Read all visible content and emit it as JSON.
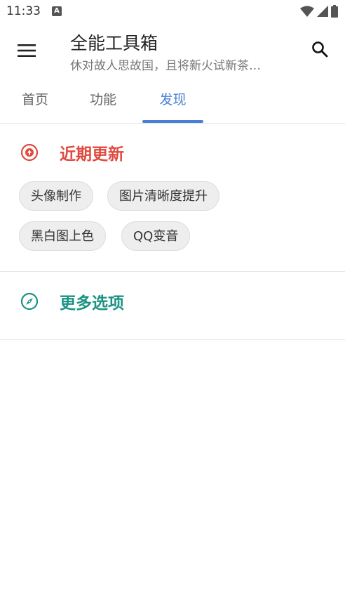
{
  "status": {
    "time": "11:33",
    "notification_icon": "A"
  },
  "app_bar": {
    "title": "全能工具箱",
    "subtitle": "休对故人思故国，且将新火试新茶…"
  },
  "tabs": [
    {
      "label": "首页"
    },
    {
      "label": "功能"
    },
    {
      "label": "发现",
      "active": true
    }
  ],
  "sections": [
    {
      "title": "近期更新",
      "icon": "arrow-up-circle-icon",
      "color": "#e04a3f",
      "chips": [
        "头像制作",
        "图片清晰度提升",
        "黑白图上色",
        "QQ变音"
      ]
    },
    {
      "title": "更多选项",
      "icon": "compass-icon",
      "color": "#1a9384"
    }
  ],
  "colors": {
    "accent": "#4a7fd6",
    "red": "#e04a3f",
    "teal": "#1a9384"
  }
}
